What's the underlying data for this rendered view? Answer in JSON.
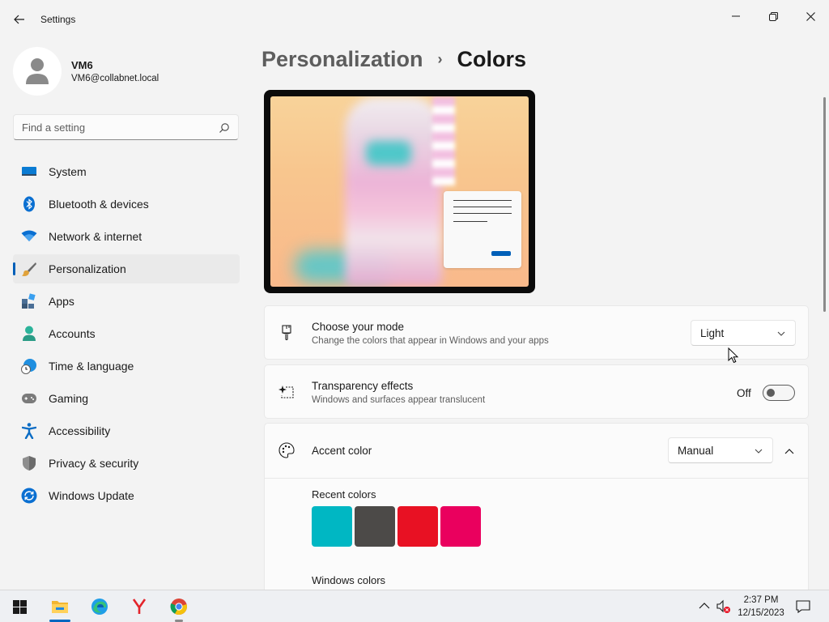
{
  "window": {
    "title": "Settings",
    "controls": [
      "minimize-icon",
      "maximize-icon",
      "close-icon"
    ]
  },
  "profile": {
    "name": "VM6",
    "email": "VM6@collabnet.local"
  },
  "search": {
    "placeholder": "Find a setting",
    "value": ""
  },
  "sidebar": {
    "items": [
      {
        "label": "System",
        "icon": "system-icon",
        "active": false
      },
      {
        "label": "Bluetooth & devices",
        "icon": "bluetooth-icon",
        "active": false
      },
      {
        "label": "Network & internet",
        "icon": "wifi-icon",
        "active": false
      },
      {
        "label": "Personalization",
        "icon": "brush-icon",
        "active": true
      },
      {
        "label": "Apps",
        "icon": "apps-icon",
        "active": false
      },
      {
        "label": "Accounts",
        "icon": "accounts-icon",
        "active": false
      },
      {
        "label": "Time & language",
        "icon": "globe-clock-icon",
        "active": false
      },
      {
        "label": "Gaming",
        "icon": "gamepad-icon",
        "active": false
      },
      {
        "label": "Accessibility",
        "icon": "accessibility-icon",
        "active": false
      },
      {
        "label": "Privacy & security",
        "icon": "shield-icon",
        "active": false
      },
      {
        "label": "Windows Update",
        "icon": "update-icon",
        "active": false
      }
    ]
  },
  "main": {
    "breadcrumb_parent": "Personalization",
    "breadcrumb_separator": "›",
    "breadcrumb_current": "Colors",
    "mode": {
      "title": "Choose your mode",
      "description": "Change the colors that appear in Windows and your apps",
      "selected": "Light"
    },
    "transparency": {
      "title": "Transparency effects",
      "description": "Windows and surfaces appear translucent",
      "state_label": "Off",
      "on": false
    },
    "accent": {
      "title": "Accent color",
      "selected": "Manual",
      "recent_label": "Recent colors",
      "recent_colors": [
        "#00b7c3",
        "#4c4a48",
        "#e81123",
        "#ea005e"
      ],
      "windows_label": "Windows colors"
    }
  },
  "taskbar": {
    "apps": [
      "start-icon",
      "file-explorer-icon",
      "edge-icon",
      "yandex-icon",
      "chrome-icon"
    ],
    "time": "2:37 PM",
    "date": "12/15/2023"
  },
  "colors": {
    "accent": "#005fb8",
    "background": "#f3f3f3",
    "card": "#fbfbfb"
  }
}
